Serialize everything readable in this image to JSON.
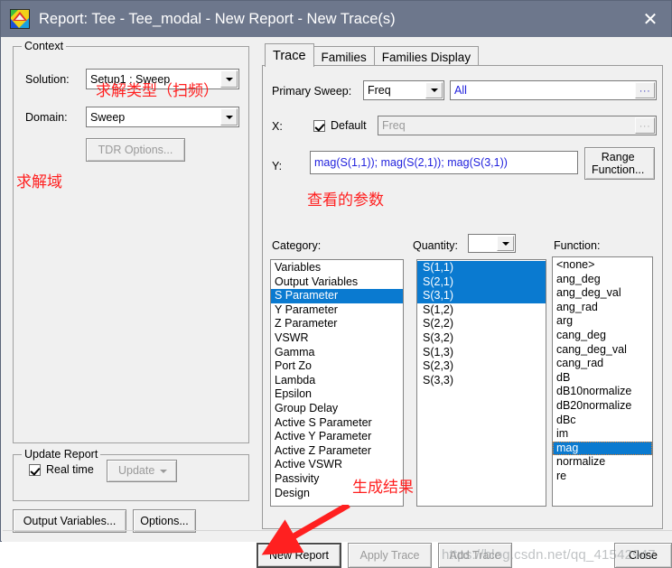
{
  "window": {
    "title": "Report: Tee - Tee_modal - New Report - New Trace(s)",
    "icon": "hfss-app-icon",
    "close_label": "✕",
    "titlebar_color": "#6d778c"
  },
  "context": {
    "group_title": "Context",
    "solution_label": "Solution:",
    "solution_value": "Setup1 : Sweep",
    "domain_label": "Domain:",
    "domain_value": "Sweep",
    "tdr_button": "TDR Options..."
  },
  "update_report": {
    "group_title": "Update Report",
    "realtime_label": "Real time",
    "realtime_checked": true,
    "update_button": "Update"
  },
  "left_buttons": {
    "output_variables": "Output Variables...",
    "options": "Options..."
  },
  "tabs": [
    {
      "label": "Trace",
      "active": true
    },
    {
      "label": "Families",
      "active": false
    },
    {
      "label": "Families Display",
      "active": false
    }
  ],
  "trace": {
    "primary_sweep_label": "Primary Sweep:",
    "primary_sweep_value": "Freq",
    "primary_sweep_range": "All",
    "x_label": "X:",
    "x_default_label": "Default",
    "x_default_checked": true,
    "x_value": "Freq",
    "y_label": "Y:",
    "y_value": "mag(S(1,1)); mag(S(2,1)); mag(S(3,1))",
    "range_function_button": "Range\nFunction...",
    "ellipsis_label": "···"
  },
  "category": {
    "label": "Category:",
    "items": [
      "Variables",
      "Output Variables",
      "S Parameter",
      "Y Parameter",
      "Z Parameter",
      "VSWR",
      "Gamma",
      "Port Zo",
      "Lambda",
      "Epsilon",
      "Group Delay",
      "Active S Parameter",
      "Active Y Parameter",
      "Active Z Parameter",
      "Active VSWR",
      "Passivity",
      "Design"
    ],
    "selected": [
      "S Parameter"
    ]
  },
  "quantity": {
    "label": "Quantity:",
    "combo_value": "",
    "items": [
      "S(1,1)",
      "S(2,1)",
      "S(3,1)",
      "S(1,2)",
      "S(2,2)",
      "S(3,2)",
      "S(1,3)",
      "S(2,3)",
      "S(3,3)"
    ],
    "selected": [
      "S(1,1)",
      "S(2,1)",
      "S(3,1)"
    ]
  },
  "function": {
    "label": "Function:",
    "items": [
      "<none>",
      "ang_deg",
      "ang_deg_val",
      "ang_rad",
      "arg",
      "cang_deg",
      "cang_deg_val",
      "cang_rad",
      "dB",
      "dB10normalize",
      "dB20normalize",
      "dBc",
      "im",
      "mag",
      "normalize",
      "re"
    ],
    "selected": [
      "mag"
    ]
  },
  "bottom_buttons": {
    "new_report": "New Report",
    "apply_trace": "Apply Trace",
    "add_trace": "Add Trace",
    "close": "Close"
  },
  "annotations": [
    {
      "id": "solve-type",
      "text": "求解类型（扫频）"
    },
    {
      "id": "solve-domain",
      "text": "求解域"
    },
    {
      "id": "view-params",
      "text": "查看的参数"
    },
    {
      "id": "generate-result",
      "text": "生成结果"
    }
  ],
  "watermark": "https://blog.csdn.net/qq_41542947",
  "colors": {
    "selection_blue": "#0a7ad0",
    "annotation_red": "#ff2020",
    "expression_blue": "#2222dd",
    "titlebar": "#6d778c"
  }
}
